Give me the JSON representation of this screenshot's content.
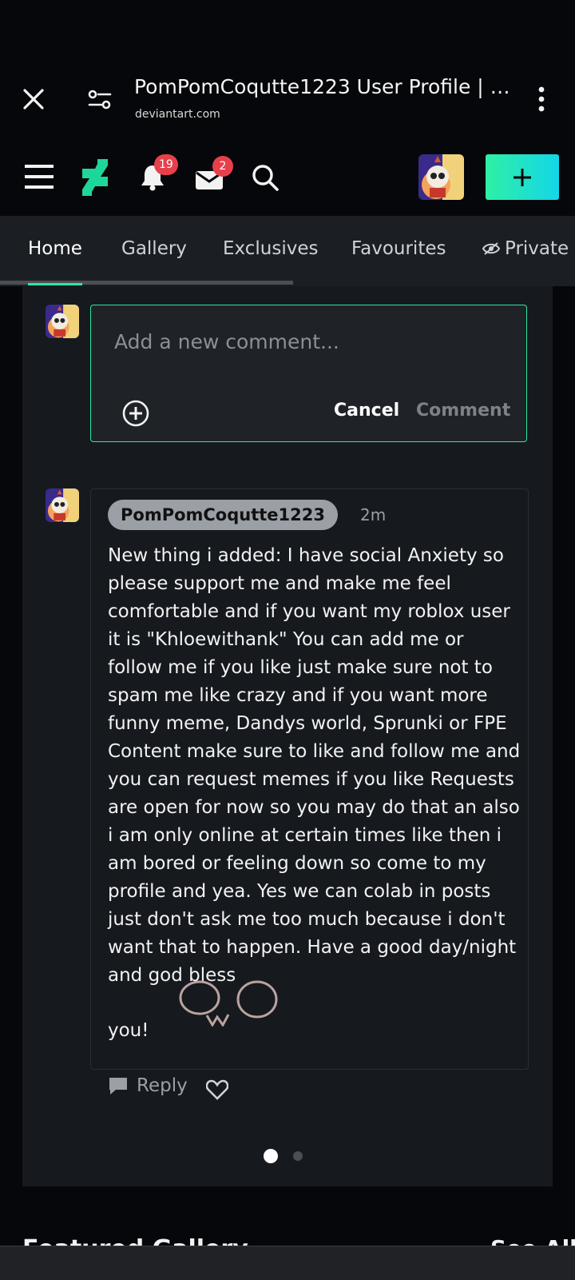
{
  "browser": {
    "title": "PomPomCoqutte1223 User Profile | D...",
    "domain": "deviantart.com"
  },
  "header": {
    "notifications_count": "19",
    "messages_count": "2"
  },
  "tabs": [
    {
      "label": "Home",
      "active": true
    },
    {
      "label": "Gallery",
      "active": false
    },
    {
      "label": "Exclusives",
      "active": false
    },
    {
      "label": "Favourites",
      "active": false
    },
    {
      "label": "Private",
      "active": false
    }
  ],
  "new_comment": {
    "placeholder": "Add a new comment...",
    "cancel_label": "Cancel",
    "comment_label": "Comment"
  },
  "post": {
    "username": "PomPomCoqutte1223",
    "time": "2m",
    "text": "New thing i added: I have social Anxiety so please support me and make me feel comfortable and if you want my roblox user it is \"Khloewithank\" You can add me or follow me if you like just make sure not to spam me like crazy and if you want more funny meme, Dandys world, Sprunki or FPE Content make sure to like and follow me and you can request memes if you like Requests are open for now so you may do that an also i am only online at certain times like then i am bored or feeling down so come to my profile and yea. Yes we can colab in posts just don't ask me too much because i don't want that to happen. Have a good day/night and god bless",
    "text_end": "you!",
    "reply_label": "Reply"
  },
  "pagination": {
    "active": 1,
    "total": 2
  },
  "featured": {
    "title": "Featured Gallery",
    "see_all": "See All"
  },
  "colors": {
    "accent": "#2ee6a0",
    "badge": "#e8404b",
    "background": "#06070a",
    "card": "#16191e"
  }
}
